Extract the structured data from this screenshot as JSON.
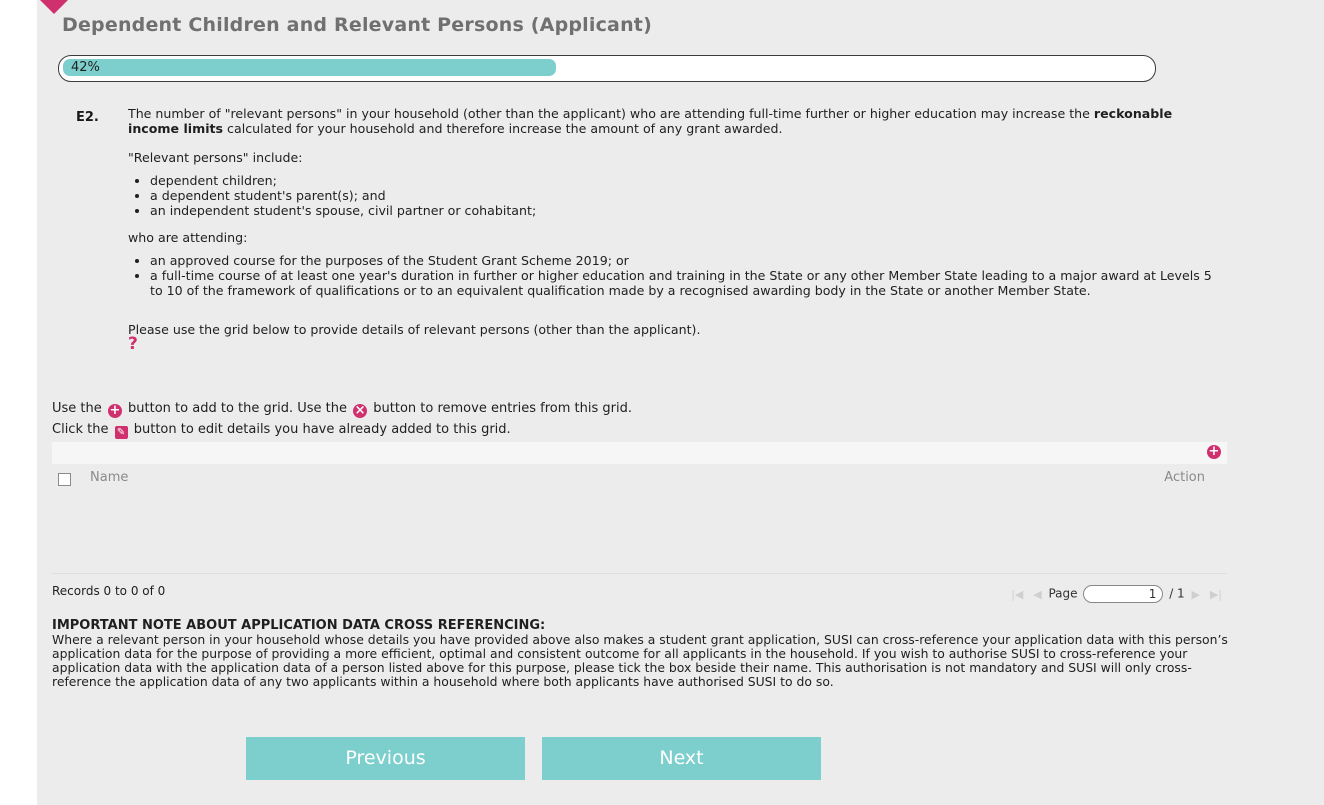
{
  "page": {
    "title": "Dependent Children and Relevant Persons (Applicant)"
  },
  "progress": {
    "value": 42,
    "label": "42%"
  },
  "question": {
    "number": "E2.",
    "paragraph_before_bold": "The number of \"relevant persons\" in your household (other than the applicant) who are attending full-time further or higher education may increase the ",
    "paragraph_bold": "reckonable income limits",
    "paragraph_after_bold": " calculated for your household and therefore increase the amount of any grant awarded.",
    "relevant_intro": "\"Relevant persons\" include:",
    "relevant_list": [
      "dependent children;",
      "a dependent student's parent(s); and",
      "an independent student's spouse, civil partner or cohabitant;"
    ],
    "attending_intro": "who are attending:",
    "attending_list": [
      "an approved course for the purposes of the Student Grant Scheme 2019; or",
      "a full-time course of at least one year's duration in further or higher education and training in the State or any other Member State leading to a major award at Levels 5 to 10 of the framework of qualifications or to an equivalent qualification made by a recognised awarding body in the State or another Member State."
    ],
    "grid_instruction": "Please use the grid below to provide details of relevant persons (other than the applicant).",
    "help_symbol": "?"
  },
  "instructions": {
    "line1_a": "Use the",
    "line1_b": "button to add to the grid. Use the",
    "line1_c": "button to remove entries from this grid.",
    "line2_a": "Click the",
    "line2_b": "button to edit details you have already added to this grid."
  },
  "grid": {
    "columns": [
      "Name",
      "Action"
    ],
    "rows": [],
    "records_text": "Records 0 to 0 of 0",
    "page_label": "Page",
    "page_value": "1",
    "page_total": "/ 1"
  },
  "note": {
    "title": "IMPORTANT NOTE ABOUT APPLICATION DATA CROSS REFERENCING:",
    "body": "Where a relevant person in your household whose details you have provided above also makes a student grant application, SUSI can cross-reference your application data with this person’s application data for the purpose of providing a more efficient, optimal and consistent outcome for all applicants in the household. If you wish to authorise SUSI to cross-reference your application data with the application data of a person listed above for this purpose, please tick the box beside their name. This authorisation is not mandatory and SUSI will only cross-reference the application data of any two applicants within a household where both applicants have authorised SUSI to do so."
  },
  "nav": {
    "previous": "Previous",
    "next": "Next"
  },
  "icons": {
    "add": "plus-circle-icon",
    "remove": "x-circle-icon",
    "edit": "edit-icon",
    "first": "first-page-icon",
    "prev": "prev-page-icon",
    "next": "next-page-icon",
    "last": "last-page-icon"
  },
  "colors": {
    "accent": "#7ccfcd",
    "icon": "#d0306e",
    "panel": "#ececec"
  }
}
